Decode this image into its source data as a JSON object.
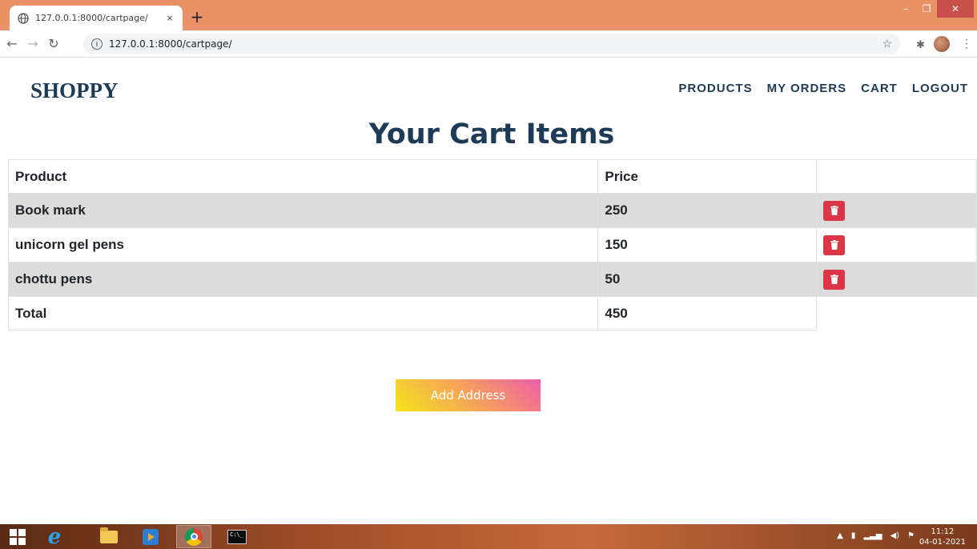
{
  "browser": {
    "tab_title": "127.0.0.1:8000/cartpage/",
    "tab_close": "×",
    "new_tab": "+",
    "url": "127.0.0.1:8000/cartpage/",
    "window_minimize": "–",
    "window_restore": "❐",
    "window_close": "✕"
  },
  "header": {
    "brand": "SHOPPY",
    "nav": [
      "PRODUCTS",
      "MY ORDERS",
      "CART",
      "LOGOUT"
    ]
  },
  "main": {
    "title": "Your Cart Items",
    "table": {
      "headers": [
        "Product",
        "Price",
        ""
      ],
      "rows": [
        {
          "product": "Book mark",
          "price": "250"
        },
        {
          "product": "unicorn gel pens",
          "price": "150"
        },
        {
          "product": "chottu pens",
          "price": "50"
        }
      ],
      "total_label": "Total",
      "total_value": "450"
    },
    "add_address_label": "Add Address",
    "colors": {
      "brand_text": "#1d3a57",
      "delete_button": "#dc3545",
      "row_stripe": "#dcdcdc"
    }
  },
  "taskbar": {
    "clock_time": "11:12",
    "clock_date": "04-01-2021",
    "items": [
      "start-icon",
      "internet-explorer-icon",
      "file-explorer-icon",
      "media-player-icon",
      "chrome-icon",
      "command-prompt-icon"
    ]
  }
}
